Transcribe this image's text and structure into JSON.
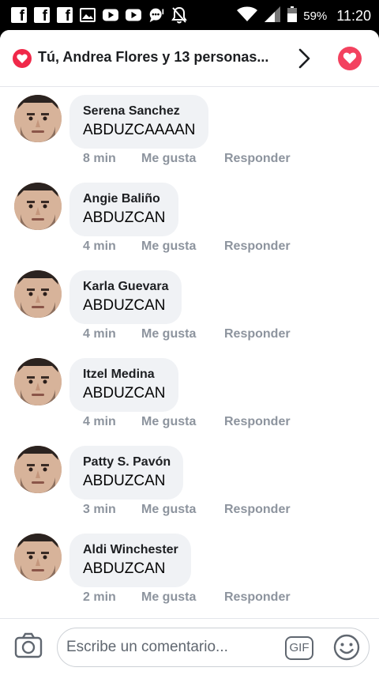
{
  "status_bar": {
    "battery_percent": "59%",
    "time": "11:20",
    "icons": [
      "facebook-notification-icon",
      "facebook-notification-icon",
      "facebook-notification-icon",
      "image-icon",
      "youtube-icon",
      "youtube-icon",
      "chat-icon",
      "silent-notification-icon",
      "wifi-icon",
      "signal-icon",
      "battery-icon"
    ]
  },
  "header": {
    "reactions_text": "Tú, Andrea Flores y 13 personas...",
    "reaction_icon": "heart-icon",
    "chevron_icon": "chevron-right-icon",
    "react_button_icon": "heart-icon"
  },
  "comments": [
    {
      "name": "Serena Sanchez",
      "text": "ABDUZCAAAAN",
      "time": "8 min",
      "like_label": "Me gusta",
      "reply_label": "Responder"
    },
    {
      "name": "Angie Baliño",
      "text": "ABDUZCAN",
      "time": "4 min",
      "like_label": "Me gusta",
      "reply_label": "Responder"
    },
    {
      "name": "Karla Guevara",
      "text": "ABDUZCAN",
      "time": "4 min",
      "like_label": "Me gusta",
      "reply_label": "Responder"
    },
    {
      "name": "Itzel Medina",
      "text": "ABDUZCAN",
      "time": "4 min",
      "like_label": "Me gusta",
      "reply_label": "Responder"
    },
    {
      "name": "Patty S. Pavón",
      "text": "ABDUZCAN",
      "time": "3 min",
      "like_label": "Me gusta",
      "reply_label": "Responder"
    },
    {
      "name": "Aldi Winchester",
      "text": "ABDUZCAN",
      "time": "2 min",
      "like_label": "Me gusta",
      "reply_label": "Responder"
    }
  ],
  "composer": {
    "placeholder": "Escribe un comentario...",
    "gif_label": "GIF",
    "camera_icon": "camera-icon",
    "emoji_icon": "emoji-icon"
  },
  "colors": {
    "heart": "#f02849",
    "bubble": "#f0f2f5",
    "meta_text": "#8d949e"
  }
}
